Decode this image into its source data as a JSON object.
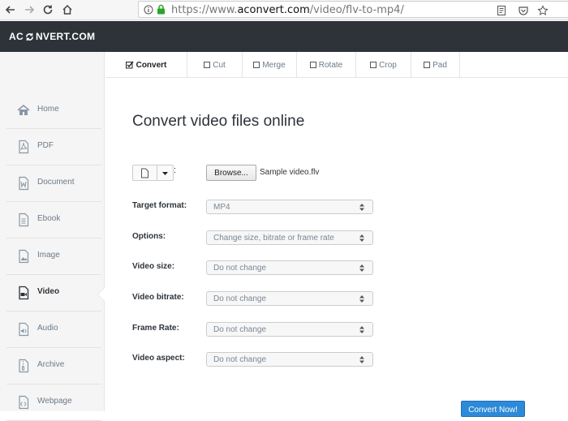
{
  "browser": {
    "url_prefix": "https://www.",
    "url_domain": "aconvert.com",
    "url_path": "/video/flv-to-mp4/"
  },
  "header": {
    "logo_left": "AC",
    "logo_right": "NVERT.COM"
  },
  "sidebar": {
    "items": [
      {
        "label": "Home",
        "icon": "home-icon"
      },
      {
        "label": "PDF",
        "icon": "pdf-icon"
      },
      {
        "label": "Document",
        "icon": "document-icon"
      },
      {
        "label": "Ebook",
        "icon": "ebook-icon"
      },
      {
        "label": "Image",
        "icon": "image-icon"
      },
      {
        "label": "Video",
        "icon": "video-icon"
      },
      {
        "label": "Audio",
        "icon": "audio-icon"
      },
      {
        "label": "Archive",
        "icon": "archive-icon"
      },
      {
        "label": "Webpage",
        "icon": "webpage-icon"
      }
    ],
    "active": "Video"
  },
  "tabs": [
    {
      "label": "Convert"
    },
    {
      "label": "Cut"
    },
    {
      "label": "Merge"
    },
    {
      "label": "Rotate"
    },
    {
      "label": "Crop"
    },
    {
      "label": "Pad"
    }
  ],
  "main": {
    "title": "Convert video files online",
    "colon": ":",
    "browse_label": "Browse...",
    "file_name": "Sample video.flv",
    "fields": [
      {
        "label": "Target format:",
        "value": "MP4"
      },
      {
        "label": "Options:",
        "value": "Change size, bitrate or frame rate"
      },
      {
        "label": "Video size:",
        "value": "Do not change"
      },
      {
        "label": "Video bitrate:",
        "value": "Do not change"
      },
      {
        "label": "Frame Rate:",
        "value": "Do not change"
      },
      {
        "label": "Video aspect:",
        "value": "Do not change"
      }
    ],
    "convert_label": "Convert Now!"
  },
  "colors": {
    "header_bg": "#2d3339",
    "accent": "#2d8ad8",
    "secure_lock": "#2aa52a"
  }
}
